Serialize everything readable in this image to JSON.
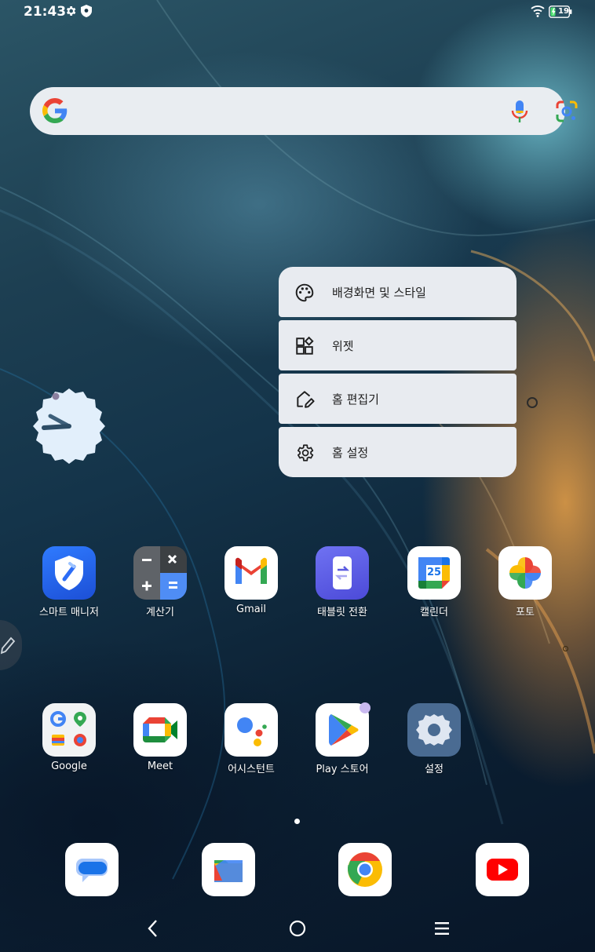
{
  "status_bar": {
    "time": "21:43",
    "battery_level": "19",
    "icons": [
      "gear-icon",
      "shield-icon",
      "wifi-icon",
      "battery-charging-icon"
    ]
  },
  "search": {
    "icons": [
      "google-g-icon",
      "mic-icon",
      "google-lens-icon"
    ]
  },
  "context_menu": {
    "items": [
      {
        "label": "배경화면 및 스타일",
        "icon": "palette-icon"
      },
      {
        "label": "위젯",
        "icon": "widgets-icon"
      },
      {
        "label": "홈 편집기",
        "icon": "home-edit-icon"
      },
      {
        "label": "홈 설정",
        "icon": "gear-icon"
      }
    ]
  },
  "apps_row1": [
    {
      "label": "스마트 매니저",
      "icon": "smart-manager-icon"
    },
    {
      "label": "계산기",
      "icon": "calculator-icon"
    },
    {
      "label": "Gmail",
      "icon": "gmail-icon"
    },
    {
      "label": "태블릿 전환",
      "icon": "tablet-switch-icon"
    },
    {
      "label": "캘린더",
      "icon": "calendar-icon",
      "calendar_day": "25"
    },
    {
      "label": "포토",
      "icon": "photos-icon"
    }
  ],
  "apps_row2": [
    {
      "label": "Google",
      "icon": "google-folder-icon"
    },
    {
      "label": "Meet",
      "icon": "meet-icon"
    },
    {
      "label": "어시스턴트",
      "icon": "assistant-icon"
    },
    {
      "label": "Play 스토어",
      "icon": "play-store-icon"
    },
    {
      "label": "설정",
      "icon": "settings-icon"
    }
  ],
  "dock": [
    "messages-icon",
    "files-icon",
    "chrome-icon",
    "youtube-icon"
  ],
  "nav_bar": [
    "back-icon",
    "home-icon",
    "recents-icon"
  ],
  "colors": {
    "menu_bg": "#e8ebf0",
    "search_bg": "#e9edf1",
    "google_blue": "#4285f4",
    "google_red": "#ea4335",
    "google_yellow": "#fbbc04",
    "google_green": "#34a853"
  }
}
